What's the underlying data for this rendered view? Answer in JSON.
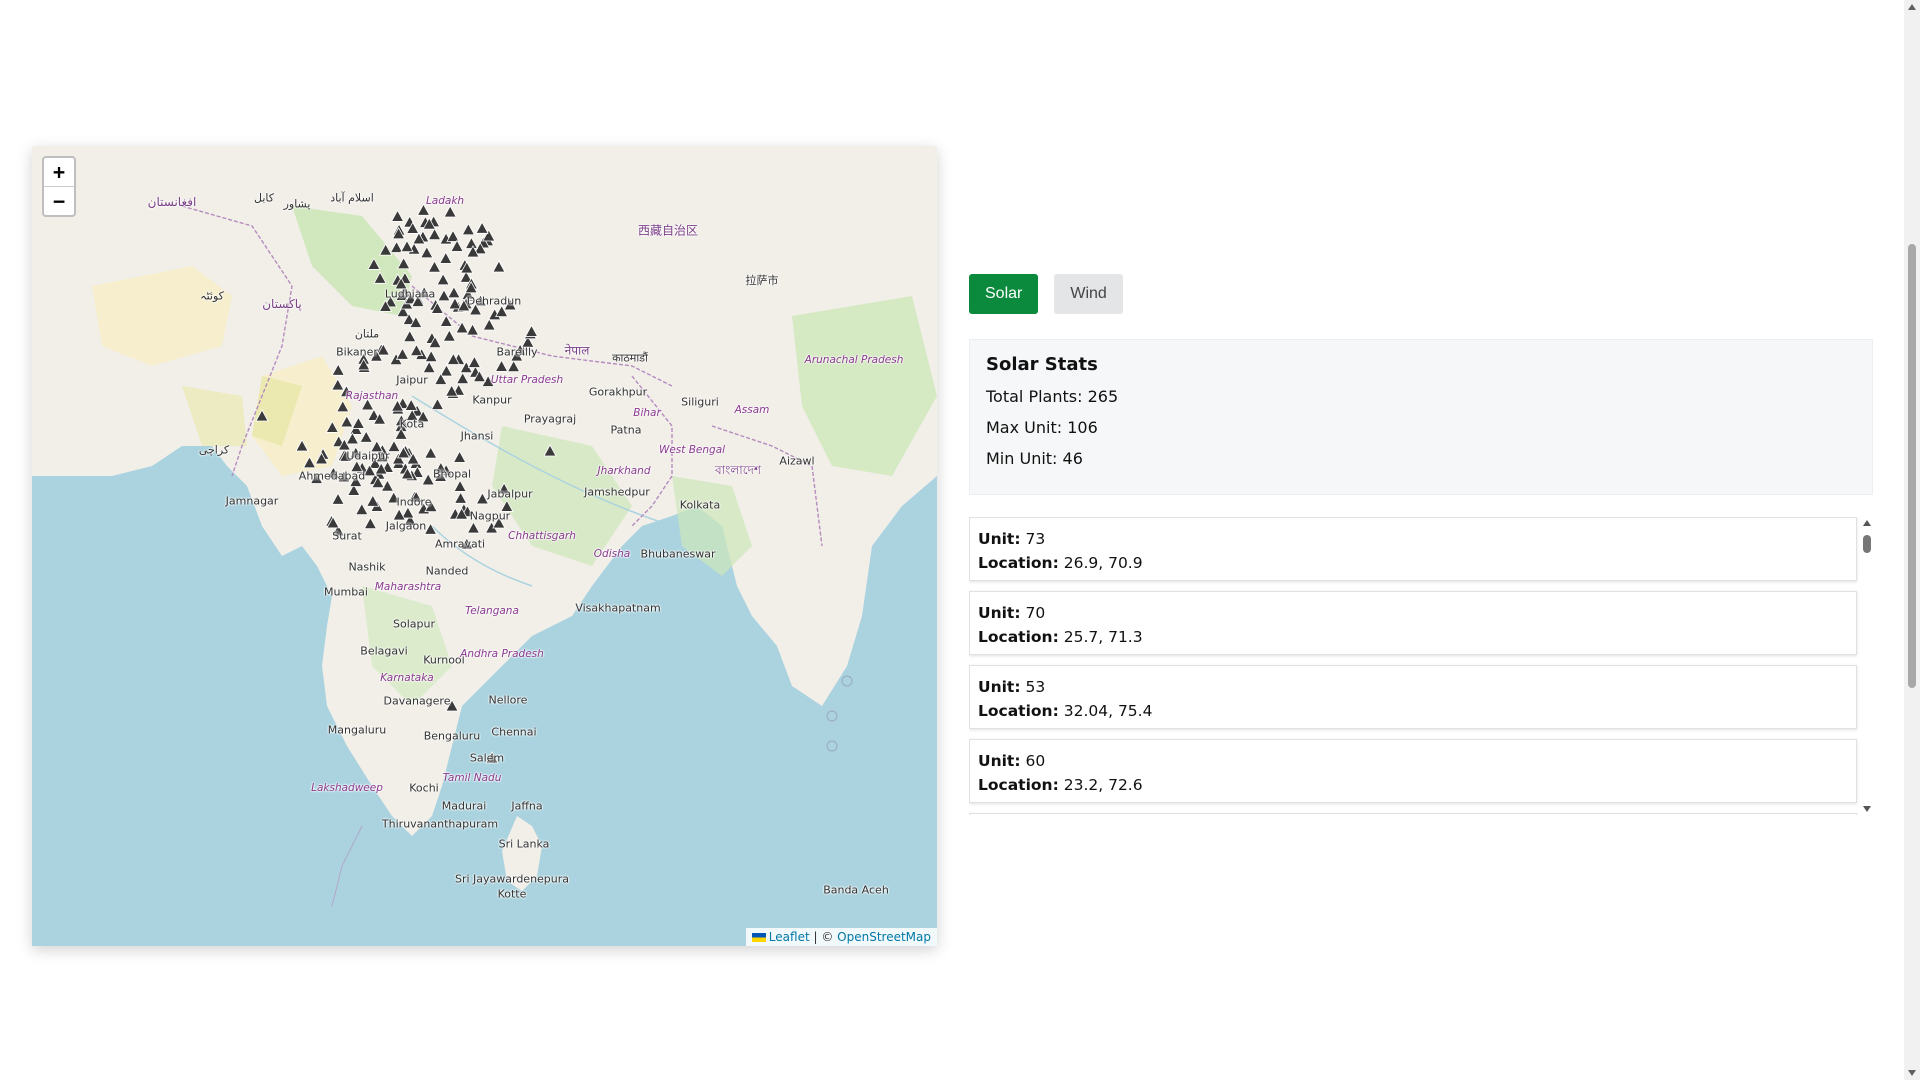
{
  "map": {
    "zoom_in": "+",
    "zoom_out": "−",
    "attribution": {
      "leaflet": "Leaflet",
      "separator": " | © ",
      "osm": "OpenStreetMap"
    },
    "labels": {
      "afghanistan": "افغانستان",
      "kabul": "کابل",
      "peshawar": "پشاور",
      "islamabad": "اسلام آباد",
      "pakistan": "پاکستان",
      "multan": "ملتان",
      "quetta": "کوئٹہ",
      "bikaner": "Bikaner",
      "jaipur": "Jaipur",
      "rajasthan": "Rajasthan",
      "kota": "Kota",
      "udaipur": "Udaipur",
      "ahmedabad": "Ahmedabad",
      "jamnagar": "Jamnagar",
      "surat": "Surat",
      "nashik": "Nashik",
      "mumbai": "Mumbai",
      "maharashtra": "Maharashtra",
      "nanded": "Nanded",
      "solapur": "Solapur",
      "belagavi": "Belagavi",
      "kurnool": "Kurnool",
      "karnataka": "Karnataka",
      "davanagere": "Davanagere",
      "mangaluru": "Mangaluru",
      "bengaluru": "Bengaluru",
      "salem": "Salem",
      "kochi": "Kochi",
      "tamil_nadu": "Tamil Nadu",
      "madurai": "Madurai",
      "thiruvananthapuram": "Thiruvananthapuram",
      "jaffna": "Jaffna",
      "sri_lanka": "Sri Lanka",
      "sri_jaya": "Sri Jayawardenepura",
      "kotte": "Kotte",
      "lakshadweep": "Lakshadweep",
      "kanpur": "Kanpur",
      "prayagraj": "Prayagraj",
      "jhansi": "Jhansi",
      "bhopal": "Bhopal",
      "indore": "Indore",
      "jabalpur": "Jabalpur",
      "jalgaon": "Jalgaon",
      "amravati": "Amravati",
      "nagpur": "Nagpur",
      "chhattisgarh": "Chhattisgarh",
      "uttar_pradesh": "Uttar Pradesh",
      "bareilly": "Bareilly",
      "dehradun": "Dehradun",
      "ludhiana": "Ludhiana",
      "ladakh": "Ladakh",
      "gorakhpur": "Gorakhpur",
      "patna": "Patna",
      "bihar": "Bihar",
      "jharkhand": "Jharkhand",
      "jamshedpur": "Jamshedpur",
      "kolkata": "Kolkata",
      "west_bengal": "West Bengal",
      "odisha": "Odisha",
      "bhubaneswar": "Bhubaneswar",
      "telangana": "Telangana",
      "visakhapatnam": "Visakhapatnam",
      "andhra": "Andhra Pradesh",
      "nellore": "Nellore",
      "chennai": "Chennai",
      "siliguri": "Siliguri",
      "assam": "Assam",
      "aizawl": "Aizawl",
      "arunachal": "Arunachal Pradesh",
      "nepal": "नेपाल",
      "kathmandu": "काठमाडौं",
      "tibet": "西藏自治区",
      "lhasa": "拉萨市",
      "bangladesh": "বাংলাদেশ",
      "banda_aceh": "Banda Aceh",
      "karachi": "کراچی"
    }
  },
  "tabs": {
    "solar": "Solar",
    "wind": "Wind"
  },
  "stats": {
    "title": "Solar Stats",
    "total": "Total Plants: 265",
    "max": "Max Unit: 106",
    "min": "Min Unit: 46"
  },
  "list": {
    "unit_label": "Unit:",
    "location_label": "Location:",
    "items": [
      {
        "unit": "73",
        "location": "26.9, 70.9"
      },
      {
        "unit": "70",
        "location": "25.7, 71.3"
      },
      {
        "unit": "53",
        "location": "32.04, 75.4"
      },
      {
        "unit": "60",
        "location": "23.2, 72.6"
      }
    ]
  },
  "colors": {
    "active_tab": "#0b8a3e",
    "inactive_tab": "#e4e5e7",
    "sea": "#aad3df",
    "land": "#f2efe9",
    "marker": "#3a3a3a"
  },
  "icons": {
    "marker": "solar-plant-marker-icon"
  }
}
